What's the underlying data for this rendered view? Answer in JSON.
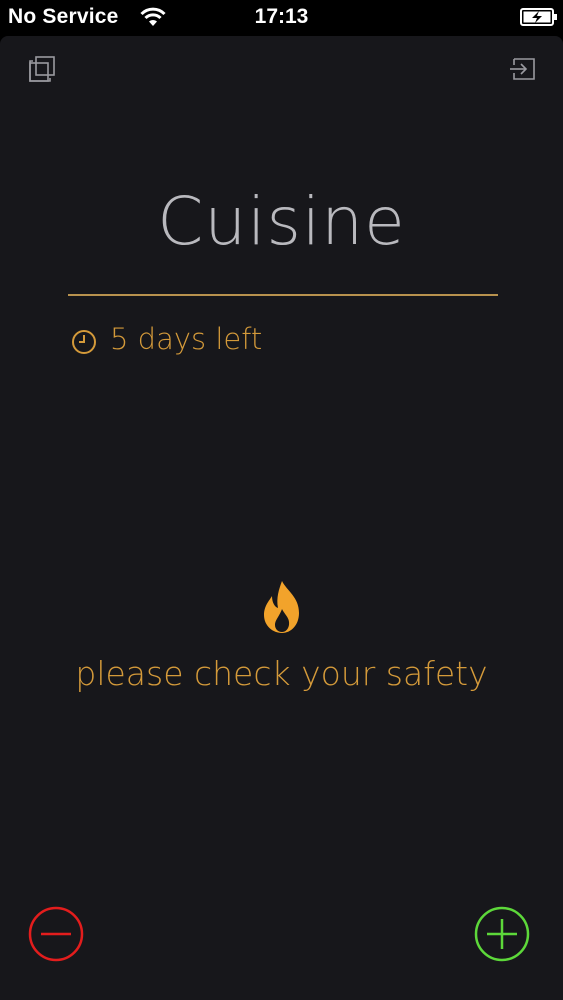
{
  "status_bar": {
    "carrier": "No Service",
    "time": "17:13"
  },
  "room": {
    "title": "Cuisine",
    "time_left": "5 days left"
  },
  "alert": {
    "message": "please check your safety",
    "icon": "fire-icon"
  },
  "colors": {
    "background": "#17171b",
    "accent": "#d49a3a",
    "divider": "#b8924e",
    "title": "#b9b9be",
    "minus": "#e31d1d",
    "plus": "#5dd83a"
  }
}
